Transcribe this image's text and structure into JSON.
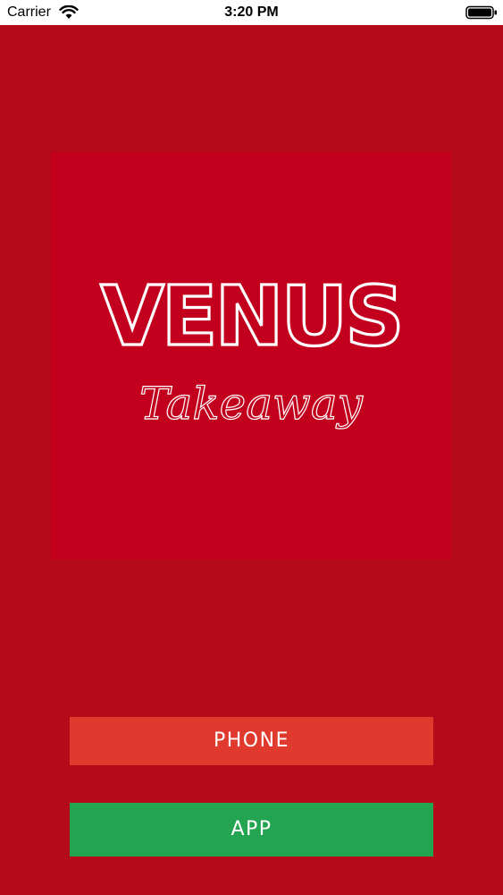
{
  "status_bar": {
    "carrier": "Carrier",
    "time": "3:20 PM",
    "wifi_icon": "wifi-icon",
    "battery_icon": "battery-icon"
  },
  "logo": {
    "title": "VENUS",
    "subtitle": "Takeaway"
  },
  "buttons": {
    "phone_label": "PHONE",
    "app_label": "APP"
  },
  "colors": {
    "background": "#b40a19",
    "logo_background": "#c2001e",
    "phone_button": "#df3a2d",
    "app_button": "#22a451",
    "text": "#ffffff"
  }
}
